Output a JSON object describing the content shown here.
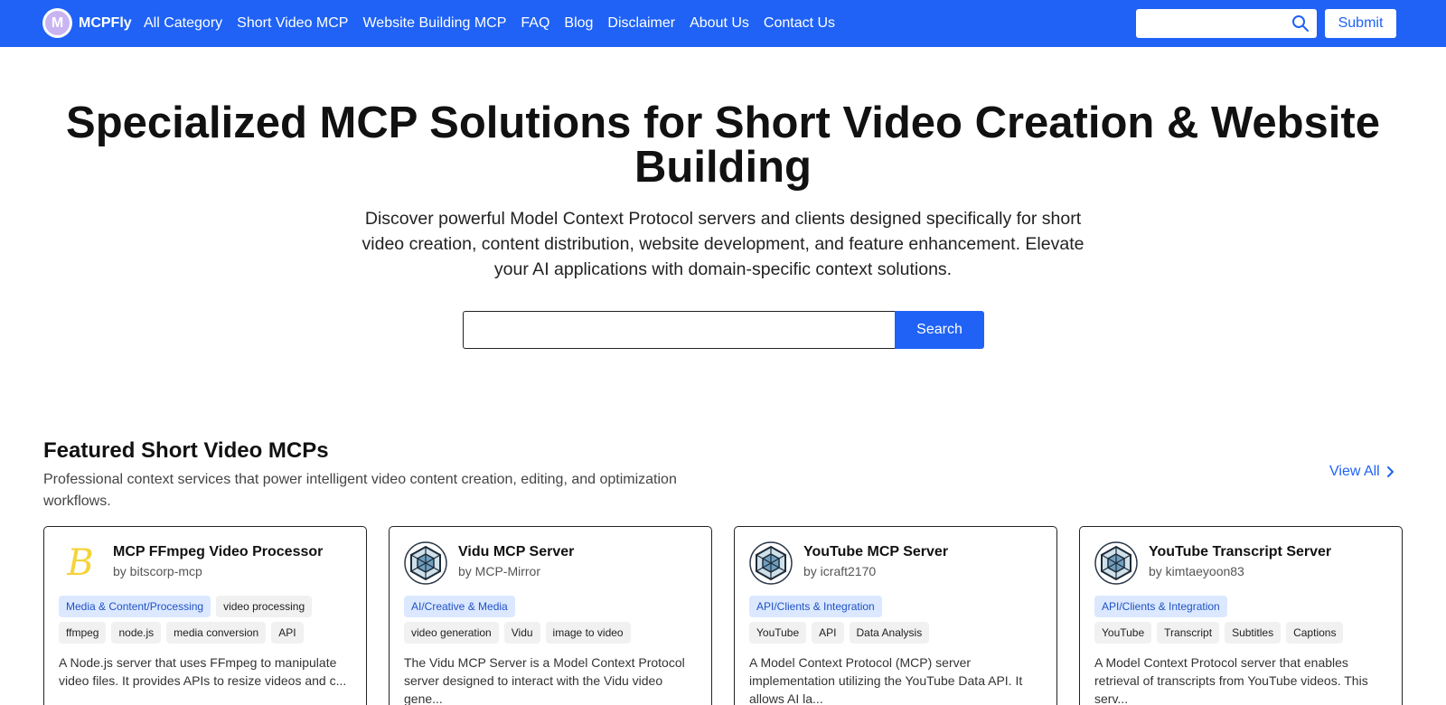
{
  "nav": {
    "brand": "MCPFly",
    "logo_letter": "M",
    "links": [
      "All Category",
      "Short Video MCP",
      "Website Building MCP",
      "FAQ",
      "Blog",
      "Disclaimer",
      "About Us",
      "Contact Us"
    ],
    "search_placeholder": "",
    "submit_label": "Submit"
  },
  "hero": {
    "title": "Specialized MCP Solutions for Short Video Creation & Website Building",
    "subtitle": "Discover powerful Model Context Protocol servers and clients designed specifically for short video creation, content distribution, website development, and feature enhancement. Elevate your AI applications with domain-specific context solutions.",
    "search_placeholder": "",
    "search_label": "Search"
  },
  "featured": {
    "title": "Featured Short Video MCPs",
    "description": "Professional context services that power intelligent video content creation, editing, and optimization workflows.",
    "view_all": "View All",
    "cards": [
      {
        "title": "MCP FFmpeg Video Processor",
        "author": "by bitscorp-mcp",
        "avatar": "B",
        "avatar_icon": "b-letter-logo-icon",
        "category": "Media & Content/Processing",
        "tags": [
          "video processing",
          "ffmpeg",
          "node.js",
          "media conversion",
          "API"
        ],
        "description": "A Node.js server that uses FFmpeg to manipulate video files. It provides APIs to resize videos and c..."
      },
      {
        "title": "Vidu MCP Server",
        "author": "by MCP-Mirror",
        "avatar_icon": "network-cube-icon",
        "category": "AI/Creative & Media",
        "tags": [
          "video generation",
          "Vidu",
          "image to video"
        ],
        "description": "The Vidu MCP Server is a Model Context Protocol server designed to interact with the Vidu video gene..."
      },
      {
        "title": "YouTube MCP Server",
        "author": "by icraft2170",
        "avatar_icon": "network-cube-icon",
        "category": "API/Clients & Integration",
        "tags": [
          "YouTube",
          "API",
          "Data Analysis"
        ],
        "description": "A Model Context Protocol (MCP) server implementation utilizing the YouTube Data API. It allows AI la..."
      },
      {
        "title": "YouTube Transcript Server",
        "author": "by kimtaeyoon83",
        "avatar_icon": "network-cube-icon",
        "category": "API/Clients & Integration",
        "tags": [
          "YouTube",
          "Transcript",
          "Subtitles",
          "Captions"
        ],
        "description": "A Model Context Protocol server that enables retrieval of transcripts from YouTube videos. This serv..."
      }
    ]
  },
  "colors": {
    "primary": "#1f62f5",
    "tag_category_bg": "#dbe8ff",
    "tag_category_text": "#2152c4",
    "tag_plain_bg": "#f1f1f1",
    "logo_circle": "#c9b4f2",
    "b_logo": "#f5d33a"
  }
}
